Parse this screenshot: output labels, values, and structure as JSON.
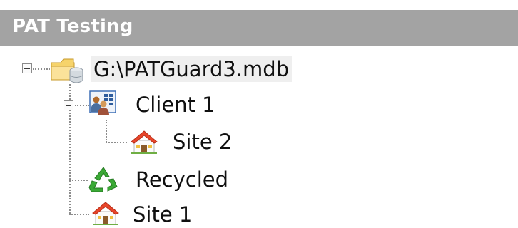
{
  "panel": {
    "title": "PAT Testing"
  },
  "tree": {
    "root": {
      "label": "G:\\PATGuard3.mdb",
      "icon": "folder-database-icon",
      "expanded": true,
      "selected": true
    },
    "client": {
      "label": "Client 1",
      "icon": "client-people-icon",
      "expanded": true
    },
    "site2": {
      "label": "Site 2",
      "icon": "house-icon"
    },
    "recycled": {
      "label": "Recycled",
      "icon": "recycle-icon"
    },
    "site1": {
      "label": "Site 1",
      "icon": "house-icon"
    }
  },
  "colors": {
    "title_bar": "#a3a3a3",
    "title_text": "#ffffff",
    "selection": "#efefef",
    "recycle_green": "#3aa935",
    "house_roof": "#e8452a"
  }
}
